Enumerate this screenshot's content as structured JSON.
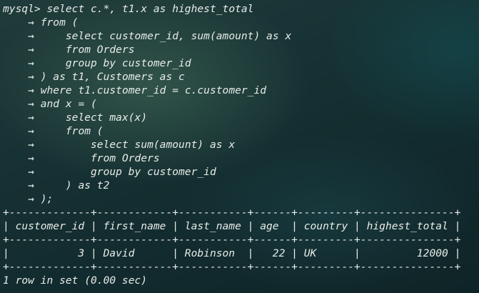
{
  "terminal": {
    "prompt": "mysql>",
    "continuation_prompt": "    →",
    "query_lines": [
      "select c.*, t1.x as highest_total",
      "from (",
      "    select customer_id, sum(amount) as x",
      "    from Orders",
      "    group by customer_id",
      ") as t1, Customers as c",
      "where t1.customer_id = c.customer_id",
      "and x = (",
      "    select max(x)",
      "    from (",
      "        select sum(amount) as x",
      "        from Orders",
      "        group by customer_id",
      "    ) as t2",
      ");"
    ],
    "table": {
      "border": "+-------------+------------+-----------+------+---------+---------------+",
      "columns": [
        "customer_id",
        "first_name",
        "last_name",
        "age",
        "country",
        "highest_total"
      ],
      "header_row": "| customer_id | first_name | last_name | age  | country | highest_total |",
      "rows": [
        {
          "customer_id": "3",
          "first_name": "David",
          "last_name": "Robinson",
          "age": "22",
          "country": "UK",
          "highest_total": "12000",
          "text": "|           3 | David      | Robinson  |   22 | UK      |         12000 |"
        }
      ]
    },
    "result_summary": "1 row in set (0.00 sec)"
  }
}
